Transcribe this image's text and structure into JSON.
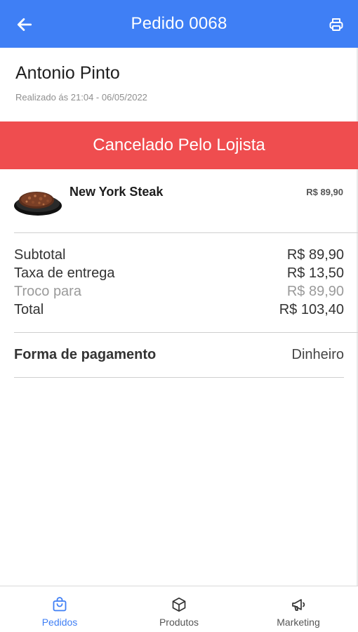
{
  "header": {
    "title": "Pedido 0068",
    "back_icon": "arrow-left-icon",
    "print_icon": "printer-icon",
    "background_color": "#3f7ff5"
  },
  "customer": {
    "name": "Antonio Pinto",
    "placed_at": "Realizado ás 21:04 - 06/05/2022"
  },
  "status": {
    "label": "Cancelado Pelo Lojista",
    "color": "#ef4d4f"
  },
  "items": [
    {
      "name": "New York Steak",
      "price": "R$ 89,90",
      "image_icon": "steak-dish-image"
    }
  ],
  "summary": {
    "subtotal_label": "Subtotal",
    "subtotal_value": "R$ 89,90",
    "delivery_label": "Taxa de entrega",
    "delivery_value": "R$ 13,50",
    "change_label": "Troco para",
    "change_value": "R$ 89,90",
    "total_label": "Total",
    "total_value": "R$ 103,40"
  },
  "payment": {
    "label": "Forma de pagamento",
    "value": "Dinheiro"
  },
  "bottom_nav": [
    {
      "label": "Pedidos",
      "icon": "shopping-bag-icon",
      "active": true
    },
    {
      "label": "Produtos",
      "icon": "box-icon",
      "active": false
    },
    {
      "label": "Marketing",
      "icon": "megaphone-icon",
      "active": false
    }
  ],
  "active_color": "#3f7ff5"
}
